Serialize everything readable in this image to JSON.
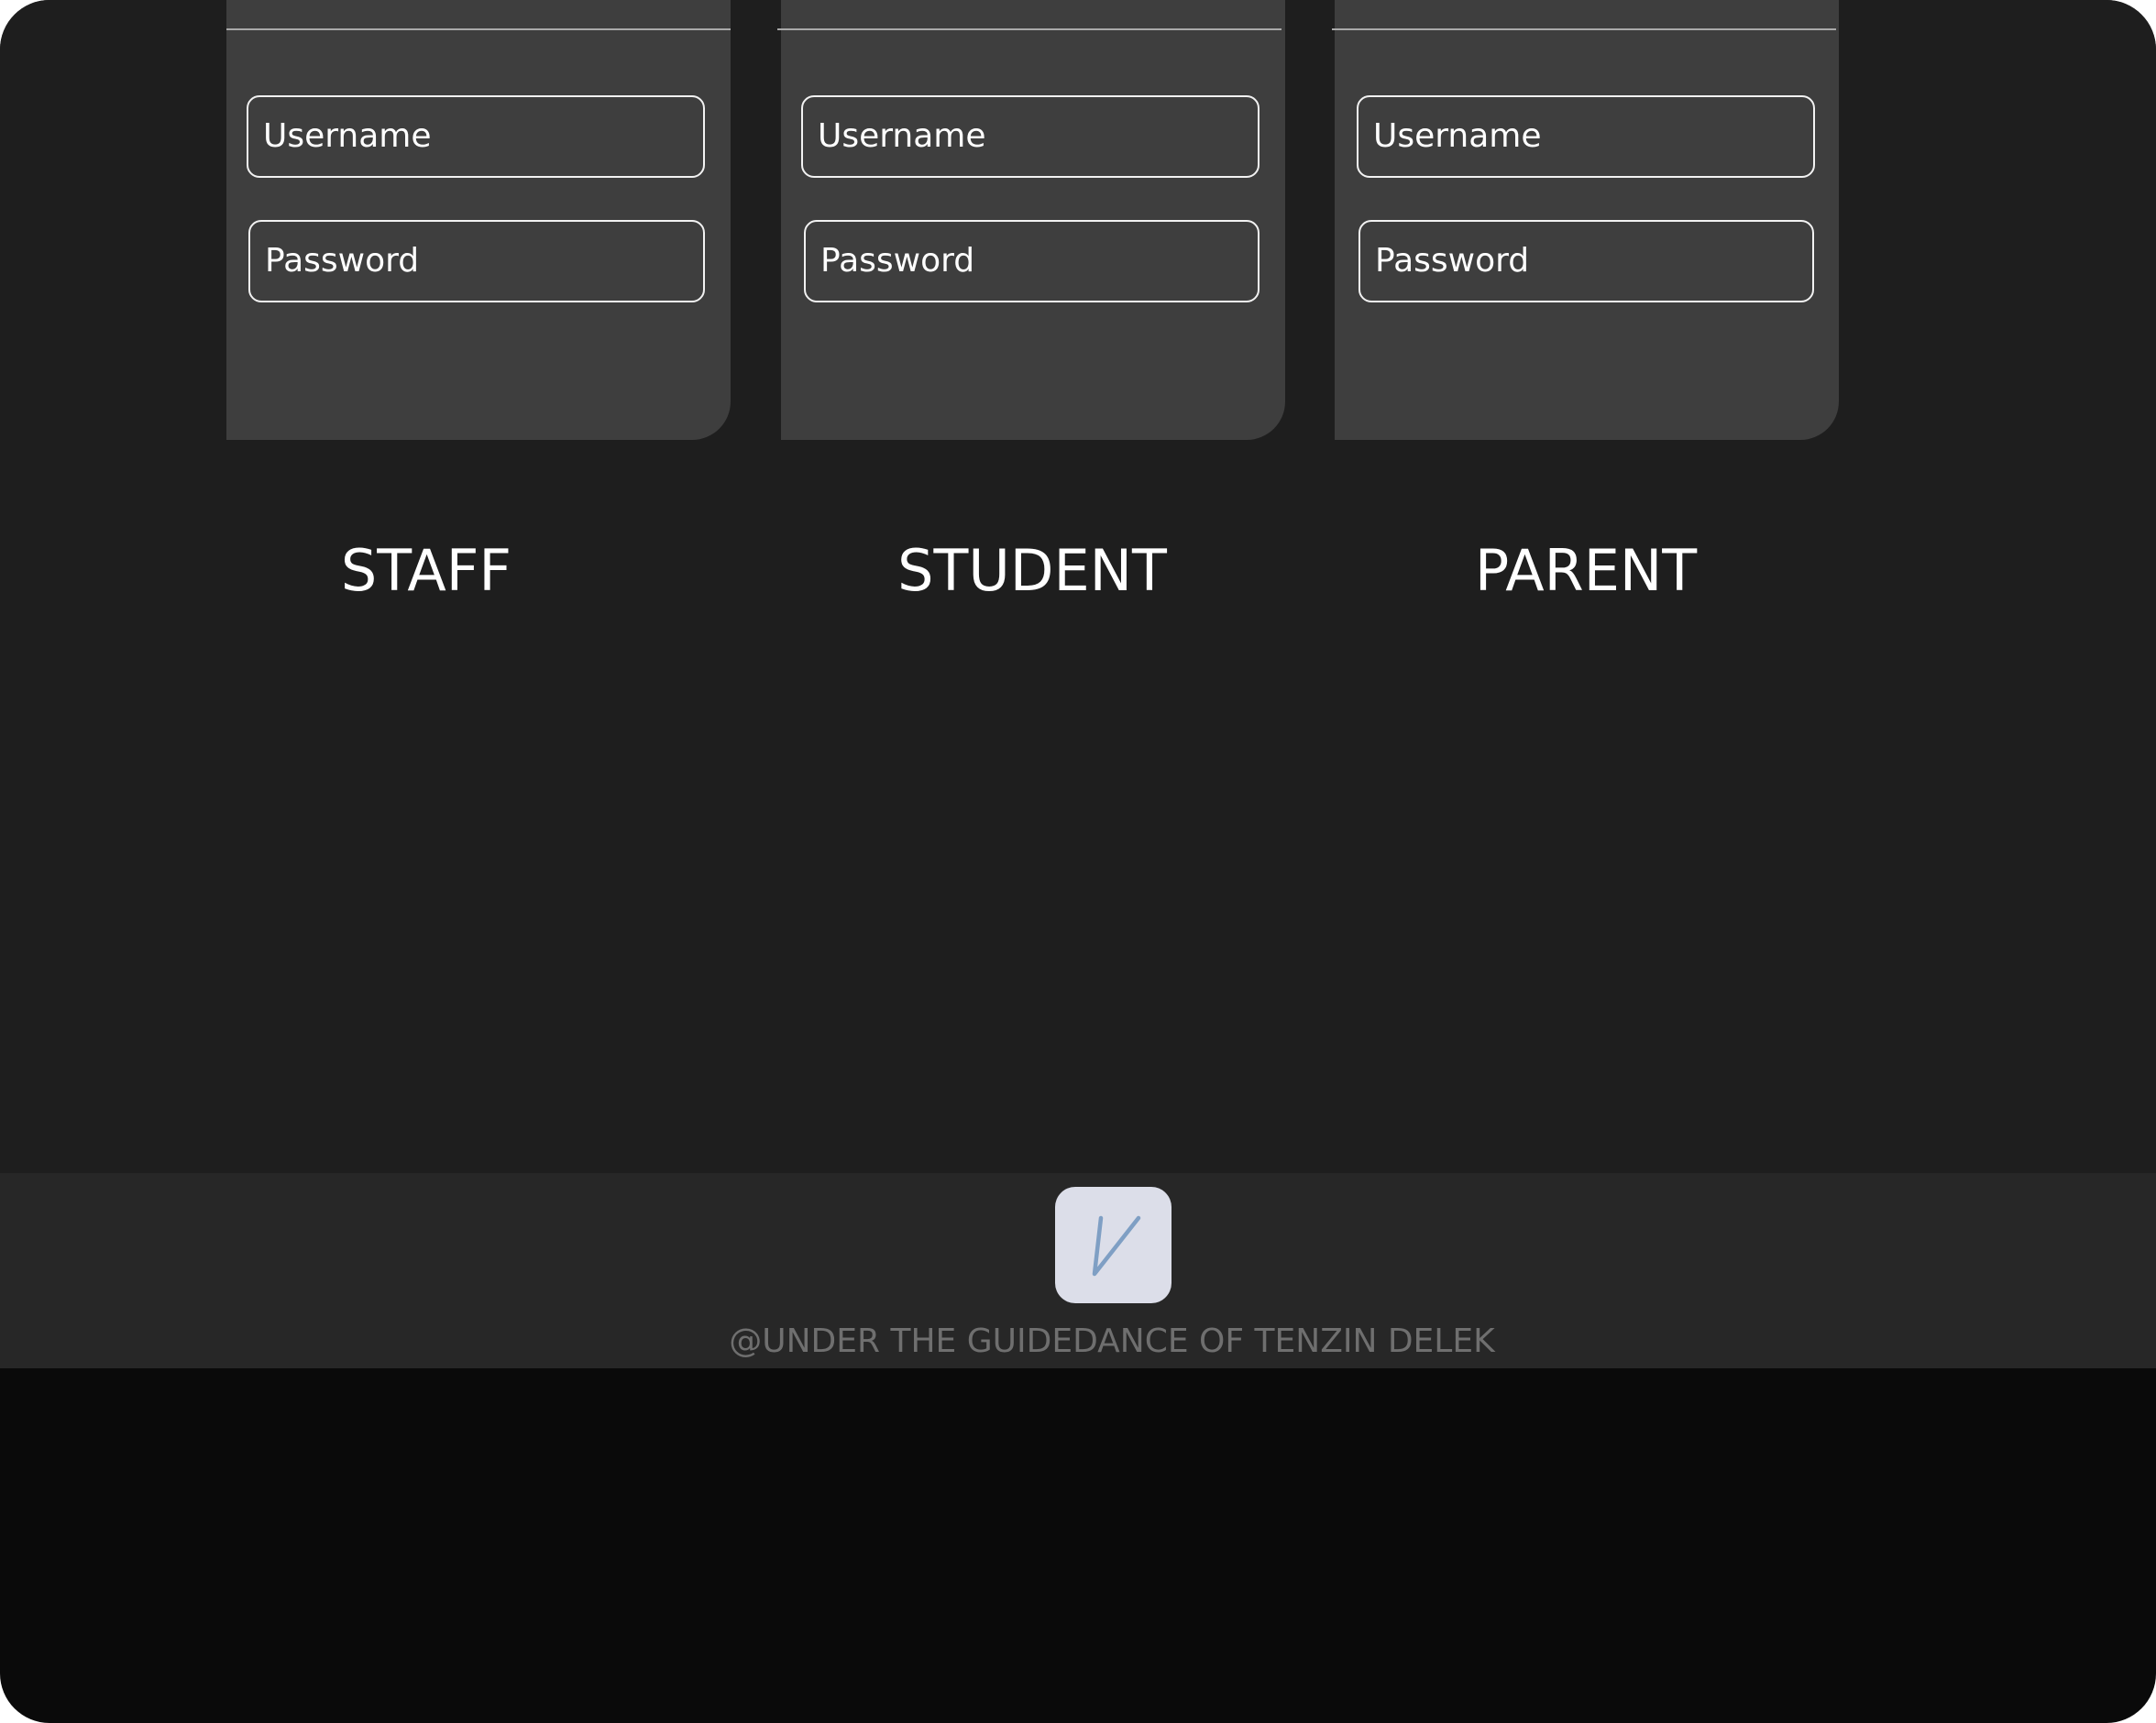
{
  "login_cards": [
    {
      "username_placeholder": "Username",
      "password_placeholder": "Password",
      "role": "STAFF"
    },
    {
      "username_placeholder": "Username",
      "password_placeholder": "Password",
      "role": "STUDENT"
    },
    {
      "username_placeholder": "Username",
      "password_placeholder": "Password",
      "role": "PARENT"
    }
  ],
  "footer": {
    "logo_icon": "v-logo-icon",
    "logo_letter": "V",
    "copyright": "@UNDER THE GUIDEDANCE OF TENZIN DELEK"
  },
  "colors": {
    "page_background": "#1e1e1e",
    "card_background": "#3e3e3e",
    "footer_background": "#272727",
    "bottom_background": "#0a0a0a",
    "logo_tile": "#dcdee9",
    "logo_letter": "#7f9fc4",
    "copyright_text": "#6f6f6f"
  }
}
